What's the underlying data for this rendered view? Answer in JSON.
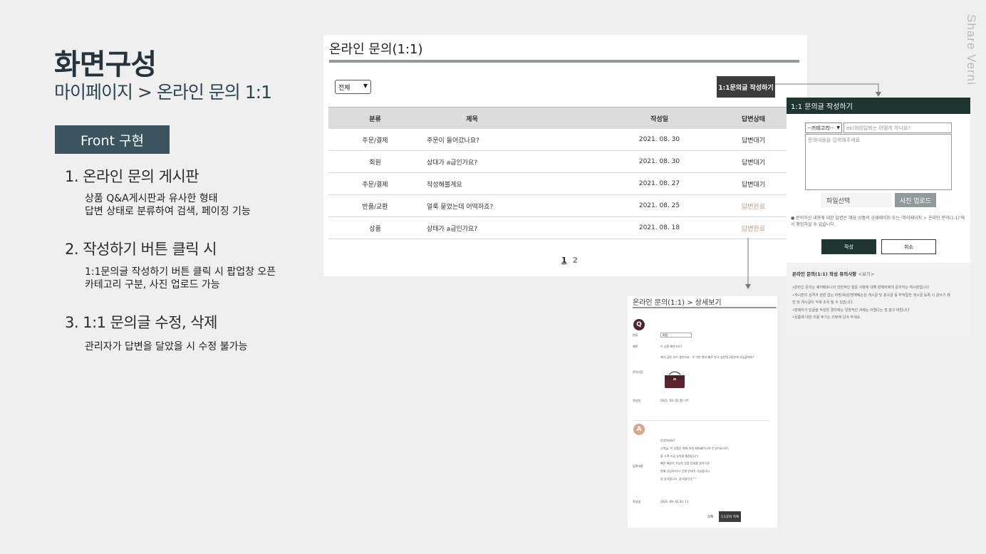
{
  "slide": {
    "heading": "화면구성",
    "subheading": "마이페이지 > 온라인 문의 1:1",
    "badge": "Front 구현",
    "brand": "Share Verni",
    "sections": [
      {
        "title": "1.  온라인 문의 게시판",
        "desc": [
          "상품 Q&A게시판과 유사한 형태",
          "답변 상태로 분류하여 검색, 페이징 기능"
        ]
      },
      {
        "title": "2.  작성하기 버튼 클릭 시",
        "desc": [
          "1:1문의글 작성하기 버튼 클릭 시 팝업창 오픈",
          "카테고리 구분, 사진 업로드 가능"
        ]
      },
      {
        "title": "3. 1:1 문의글 수정, 삭제",
        "desc": [
          "관리자가 답변을 달았을 시 수정 불가능"
        ]
      }
    ]
  },
  "board": {
    "title": "온라인 문의(1:1)",
    "filter_value": "전체",
    "write_button": "1:1문의글 작성하기",
    "columns": [
      "분류",
      "제목",
      "작성일",
      "답변상태"
    ],
    "rows": [
      {
        "category": "주문/결제",
        "title": "주문이 들어갔나요?",
        "date": "2021. 08. 30",
        "status": "답변대기",
        "done": false
      },
      {
        "category": "회원",
        "title": "상대가 a급인가요?",
        "date": "2021. 08. 30",
        "status": "답변대기",
        "done": false
      },
      {
        "category": "주문/결제",
        "title": "작성해볼게요",
        "date": "2021. 08. 27",
        "status": "답변대기",
        "done": false
      },
      {
        "category": "반품/교환",
        "title": "얼룩 묻었는데 어떡하죠?",
        "date": "2021. 08. 25",
        "status": "답변완료",
        "done": true
      },
      {
        "category": "상품",
        "title": "상태가 a급인가요?",
        "date": "2021. 08. 18",
        "status": "답변완료",
        "done": true
      }
    ],
    "pages": [
      "1",
      "2"
    ],
    "status_done_color": "#c6a07e"
  },
  "popup": {
    "title": "1:1 문의글 작성하기",
    "category_placeholder": "--카테고리--",
    "title_placeholder": "ex)회원탈퇴는 어떻게 하나요?",
    "content_placeholder": "문의내용을 입력해주세요",
    "file_label": "파일선택",
    "upload_button": "사진 업로드",
    "notice": "● 문의하신 내용에 대한 답변은 해당 상품의 상세페이지 또는 '마이페이지 > 온라인 문의(1:1)'에서 확인하실 수 있습니다.",
    "submit_button": "작성",
    "cancel_button": "취소",
    "guide_title": "온라인 문의(1:1) 작성 유의사항",
    "guide_more": "<보기>",
    "guide_lines": [
      "•온라인 문의는 쉐어베르니의 전반적인 질문 사항에 대해 판매자에게 문의하는 게시판입니다",
      "•게시판의 성격과 관련 없는 비방/욕설/명예훼손성 게시글 및 광고글 등 부적절한 게시글 등록 시 글쓰기 제",
      "한 및 게시글이 삭제 조치 될 수 있습니다.",
      "•판매자가 답글을 작성한 경우에는 일방적인 삭제는 어렵다는 점 참고 바랍니다",
      "•상품에 대한 이용 후기는 리뷰에 남겨 주세요."
    ]
  },
  "detail": {
    "title": "온라인 문의(1:1) > 상세보기",
    "q_mark": "Q",
    "a_mark": "A",
    "labels": {
      "category": "분류",
      "subject": "제목",
      "photo": "문의사진",
      "date": "작성일",
      "answer": "답변내용"
    },
    "category_value": "회원",
    "subject_value": "이 상품 빠른가요?",
    "body_value": "제가 급한 일이 생겨서요.. 꼭 이번 행사 빠르 받고 싶은데 2일안에 가능할까요?",
    "q_date": "2021. 09. 02 20: 07",
    "answer_lines": [
      "안녕하세요!",
      "고객님, 이 상품은 현재 저희 쉐어베르니에 안 있어요으로,",
      "둘 고객 조금 늦어질 예정입니다.",
      "빠른 배송이 가능한 상품 안내를 원하시면",
      "판매 상담에 다시 단계 안내가 가능합니다.",
      "양 감사합니다. 감사합니다^^"
    ],
    "a_date": "2021. 09. 02 20: 11",
    "delete_button": "삭제",
    "edit_button": "1:1문의 목록"
  }
}
